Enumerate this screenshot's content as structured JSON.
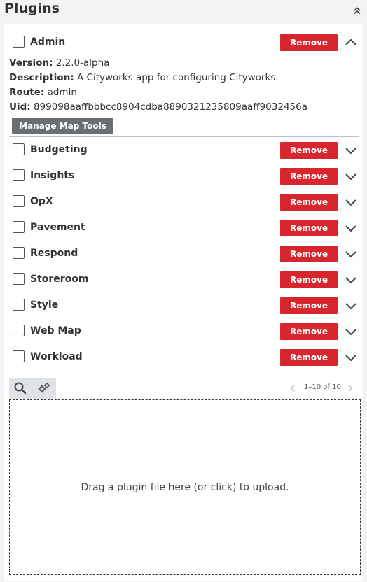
{
  "header": {
    "title": "Plugins",
    "collapse_icon": "double-chevron-up-icon"
  },
  "colors": {
    "remove_button": "#d8262f",
    "manage_button": "#6b6e73",
    "divider_accent": "#3aa6c8"
  },
  "plugins": [
    {
      "name": "Admin",
      "remove_label": "Remove",
      "expanded": true
    },
    {
      "name": "Budgeting",
      "remove_label": "Remove",
      "expanded": false
    },
    {
      "name": "Insights",
      "remove_label": "Remove",
      "expanded": false
    },
    {
      "name": "OpX",
      "remove_label": "Remove",
      "expanded": false
    },
    {
      "name": "Pavement",
      "remove_label": "Remove",
      "expanded": false
    },
    {
      "name": "Respond",
      "remove_label": "Remove",
      "expanded": false
    },
    {
      "name": "Storeroom",
      "remove_label": "Remove",
      "expanded": false
    },
    {
      "name": "Style",
      "remove_label": "Remove",
      "expanded": false
    },
    {
      "name": "Web Map",
      "remove_label": "Remove",
      "expanded": false
    },
    {
      "name": "Workload",
      "remove_label": "Remove",
      "expanded": false
    }
  ],
  "details": {
    "version_label": "Version:",
    "version": "2.2.0-alpha",
    "description_label": "Description:",
    "description": "A Cityworks app for configuring Cityworks.",
    "route_label": "Route:",
    "route": "admin",
    "uid_label": "Uid:",
    "uid": "899098aaffbbbcc8904cdba8890321235809aaff9032456a",
    "manage_label": "Manage Map Tools"
  },
  "toolbar": {
    "search_icon": "search-icon",
    "settings_icon": "gears-icon"
  },
  "pager": {
    "text": "1–10 of 10"
  },
  "dropzone": {
    "text": "Drag a plugin file here (or click) to upload."
  }
}
